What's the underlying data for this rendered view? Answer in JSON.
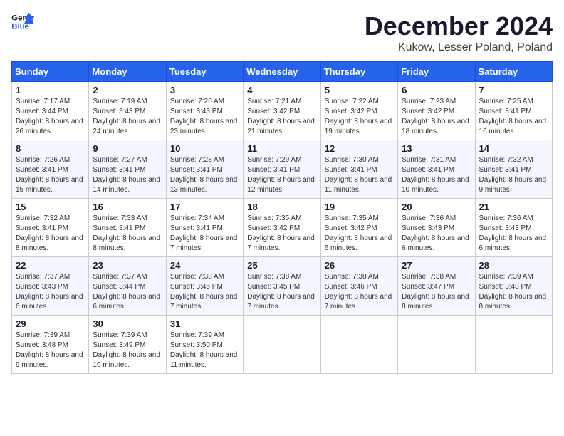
{
  "header": {
    "logo_line1": "General",
    "logo_line2": "Blue",
    "month": "December 2024",
    "location": "Kukow, Lesser Poland, Poland"
  },
  "weekdays": [
    "Sunday",
    "Monday",
    "Tuesday",
    "Wednesday",
    "Thursday",
    "Friday",
    "Saturday"
  ],
  "weeks": [
    [
      {
        "day": "1",
        "sunrise": "7:17 AM",
        "sunset": "3:44 PM",
        "daylight": "8 hours and 26 minutes."
      },
      {
        "day": "2",
        "sunrise": "7:19 AM",
        "sunset": "3:43 PM",
        "daylight": "8 hours and 24 minutes."
      },
      {
        "day": "3",
        "sunrise": "7:20 AM",
        "sunset": "3:43 PM",
        "daylight": "8 hours and 23 minutes."
      },
      {
        "day": "4",
        "sunrise": "7:21 AM",
        "sunset": "3:42 PM",
        "daylight": "8 hours and 21 minutes."
      },
      {
        "day": "5",
        "sunrise": "7:22 AM",
        "sunset": "3:42 PM",
        "daylight": "8 hours and 19 minutes."
      },
      {
        "day": "6",
        "sunrise": "7:23 AM",
        "sunset": "3:42 PM",
        "daylight": "8 hours and 18 minutes."
      },
      {
        "day": "7",
        "sunrise": "7:25 AM",
        "sunset": "3:41 PM",
        "daylight": "8 hours and 16 minutes."
      }
    ],
    [
      {
        "day": "8",
        "sunrise": "7:26 AM",
        "sunset": "3:41 PM",
        "daylight": "8 hours and 15 minutes."
      },
      {
        "day": "9",
        "sunrise": "7:27 AM",
        "sunset": "3:41 PM",
        "daylight": "8 hours and 14 minutes."
      },
      {
        "day": "10",
        "sunrise": "7:28 AM",
        "sunset": "3:41 PM",
        "daylight": "8 hours and 13 minutes."
      },
      {
        "day": "11",
        "sunrise": "7:29 AM",
        "sunset": "3:41 PM",
        "daylight": "8 hours and 12 minutes."
      },
      {
        "day": "12",
        "sunrise": "7:30 AM",
        "sunset": "3:41 PM",
        "daylight": "8 hours and 11 minutes."
      },
      {
        "day": "13",
        "sunrise": "7:31 AM",
        "sunset": "3:41 PM",
        "daylight": "8 hours and 10 minutes."
      },
      {
        "day": "14",
        "sunrise": "7:32 AM",
        "sunset": "3:41 PM",
        "daylight": "8 hours and 9 minutes."
      }
    ],
    [
      {
        "day": "15",
        "sunrise": "7:32 AM",
        "sunset": "3:41 PM",
        "daylight": "8 hours and 8 minutes."
      },
      {
        "day": "16",
        "sunrise": "7:33 AM",
        "sunset": "3:41 PM",
        "daylight": "8 hours and 8 minutes."
      },
      {
        "day": "17",
        "sunrise": "7:34 AM",
        "sunset": "3:41 PM",
        "daylight": "8 hours and 7 minutes."
      },
      {
        "day": "18",
        "sunrise": "7:35 AM",
        "sunset": "3:42 PM",
        "daylight": "8 hours and 7 minutes."
      },
      {
        "day": "19",
        "sunrise": "7:35 AM",
        "sunset": "3:42 PM",
        "daylight": "8 hours and 6 minutes."
      },
      {
        "day": "20",
        "sunrise": "7:36 AM",
        "sunset": "3:43 PM",
        "daylight": "8 hours and 6 minutes."
      },
      {
        "day": "21",
        "sunrise": "7:36 AM",
        "sunset": "3:43 PM",
        "daylight": "8 hours and 6 minutes."
      }
    ],
    [
      {
        "day": "22",
        "sunrise": "7:37 AM",
        "sunset": "3:43 PM",
        "daylight": "8 hours and 6 minutes."
      },
      {
        "day": "23",
        "sunrise": "7:37 AM",
        "sunset": "3:44 PM",
        "daylight": "8 hours and 6 minutes."
      },
      {
        "day": "24",
        "sunrise": "7:38 AM",
        "sunset": "3:45 PM",
        "daylight": "8 hours and 7 minutes."
      },
      {
        "day": "25",
        "sunrise": "7:38 AM",
        "sunset": "3:45 PM",
        "daylight": "8 hours and 7 minutes."
      },
      {
        "day": "26",
        "sunrise": "7:38 AM",
        "sunset": "3:46 PM",
        "daylight": "8 hours and 7 minutes."
      },
      {
        "day": "27",
        "sunrise": "7:38 AM",
        "sunset": "3:47 PM",
        "daylight": "8 hours and 8 minutes."
      },
      {
        "day": "28",
        "sunrise": "7:39 AM",
        "sunset": "3:48 PM",
        "daylight": "8 hours and 8 minutes."
      }
    ],
    [
      {
        "day": "29",
        "sunrise": "7:39 AM",
        "sunset": "3:48 PM",
        "daylight": "8 hours and 9 minutes."
      },
      {
        "day": "30",
        "sunrise": "7:39 AM",
        "sunset": "3:49 PM",
        "daylight": "8 hours and 10 minutes."
      },
      {
        "day": "31",
        "sunrise": "7:39 AM",
        "sunset": "3:50 PM",
        "daylight": "8 hours and 11 minutes."
      },
      null,
      null,
      null,
      null
    ]
  ],
  "labels": {
    "sunrise": "Sunrise:",
    "sunset": "Sunset:",
    "daylight": "Daylight:"
  }
}
